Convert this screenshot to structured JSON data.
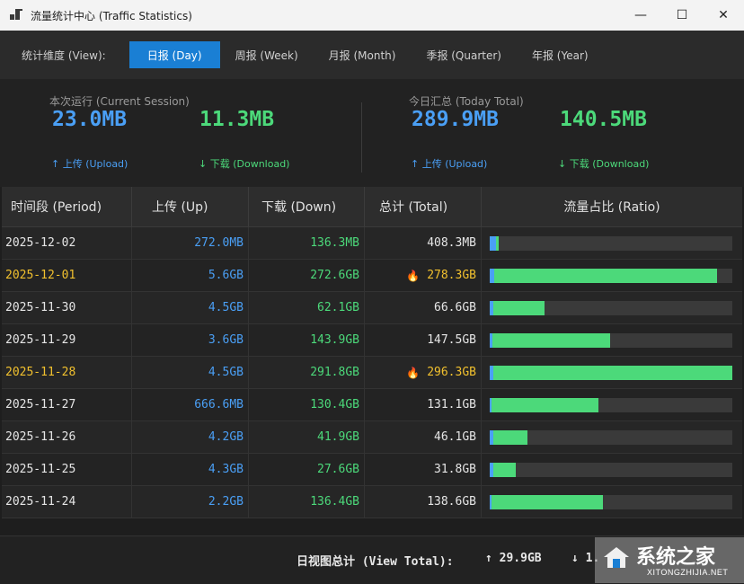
{
  "window": {
    "title": "流量统计中心 (Traffic Statistics)",
    "minimize": "—",
    "maximize": "☐",
    "close": "✕"
  },
  "nav": {
    "label": "统计维度 (View):",
    "tabs": [
      {
        "label": "日报 (Day)",
        "active": true
      },
      {
        "label": "周报 (Week)",
        "active": false
      },
      {
        "label": "月报 (Month)",
        "active": false
      },
      {
        "label": "季报 (Quarter)",
        "active": false
      },
      {
        "label": "年报 (Year)",
        "active": false
      }
    ]
  },
  "session": {
    "label": "本次运行 (Current Session)",
    "upload_value": "23.0MB",
    "download_value": "11.3MB",
    "upload_label": "↑ 上传 (Upload)",
    "download_label": "↓ 下载 (Download)"
  },
  "today": {
    "label": "今日汇总 (Today Total)",
    "upload_value": "289.9MB",
    "download_value": "140.5MB",
    "upload_label": "↑ 上传 (Upload)",
    "download_label": "↓ 下载 (Download)"
  },
  "table": {
    "headers": [
      "时间段 (Period)",
      "上传 (Up)",
      "下载 (Down)",
      "总计 (Total)",
      "流量占比 (Ratio)"
    ],
    "rows": [
      {
        "period": "2025-12-02",
        "up": "272.0MB",
        "down": "136.3MB",
        "total": "408.3MB",
        "peak": false,
        "up_ratio": 0.0256,
        "down_ratio": 0.0128
      },
      {
        "period": "2025-12-01",
        "up": "5.6GB",
        "down": "272.6GB",
        "total": "278.3GB",
        "peak": true,
        "up_ratio": 0.0189,
        "down_ratio": 0.9203
      },
      {
        "period": "2025-11-30",
        "up": "4.5GB",
        "down": "62.1GB",
        "total": "66.6GB",
        "peak": false,
        "up_ratio": 0.0152,
        "down_ratio": 0.2096
      },
      {
        "period": "2025-11-29",
        "up": "3.6GB",
        "down": "143.9GB",
        "total": "147.5GB",
        "peak": false,
        "up_ratio": 0.0122,
        "down_ratio": 0.4858
      },
      {
        "period": "2025-11-28",
        "up": "4.5GB",
        "down": "291.8GB",
        "total": "296.3GB",
        "peak": true,
        "up_ratio": 0.0152,
        "down_ratio": 0.9848
      },
      {
        "period": "2025-11-27",
        "up": "666.6MB",
        "down": "130.4GB",
        "total": "131.1GB",
        "peak": false,
        "up_ratio": 0.0022,
        "down_ratio": 0.4402
      },
      {
        "period": "2025-11-26",
        "up": "4.2GB",
        "down": "41.9GB",
        "total": "46.1GB",
        "peak": false,
        "up_ratio": 0.0142,
        "down_ratio": 0.1414
      },
      {
        "period": "2025-11-25",
        "up": "4.3GB",
        "down": "27.6GB",
        "total": "31.8GB",
        "peak": false,
        "up_ratio": 0.0145,
        "down_ratio": 0.0932
      },
      {
        "period": "2025-11-24",
        "up": "2.2GB",
        "down": "136.4GB",
        "total": "138.6GB",
        "peak": false,
        "up_ratio": 0.0074,
        "down_ratio": 0.4604
      }
    ],
    "peak_icon": "flame-icon",
    "peak_glyph": "🔥"
  },
  "footer": {
    "label": "日视图总计 (View Total):",
    "up": "↑ 29.9GB",
    "down": "↓ 1."
  },
  "watermark": {
    "text": "系统之家",
    "sub": "XITONGZHIJIA.NET"
  },
  "colors": {
    "accent": "#1a7fd4",
    "upload": "#4a9ff5",
    "download": "#4cd97a",
    "peak": "#f2c12e"
  }
}
